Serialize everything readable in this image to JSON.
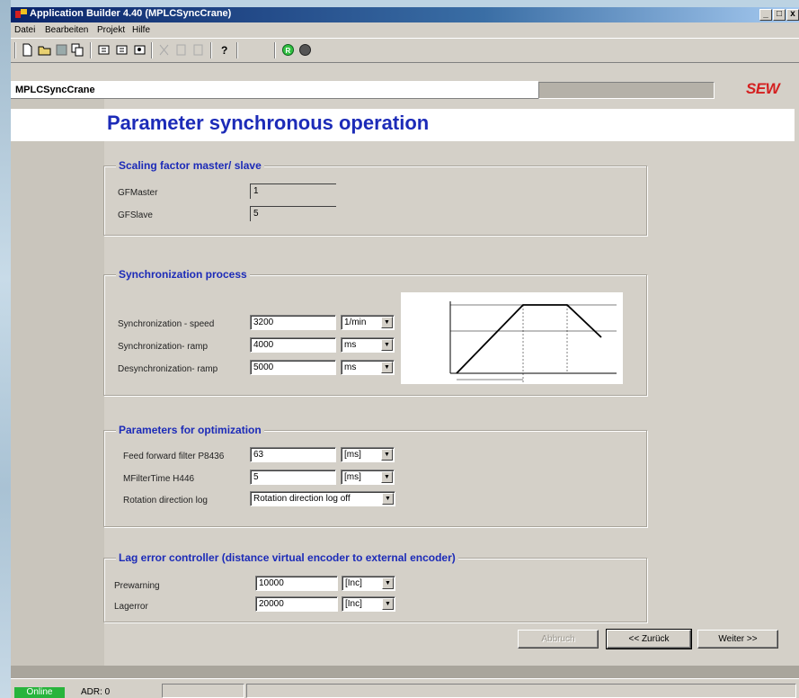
{
  "window": {
    "title": "Application Builder  4.40 (MPLCSyncCrane)",
    "controls": {
      "minimize": "_",
      "maximize": "□",
      "close": "x"
    }
  },
  "menu": {
    "items": [
      {
        "label": "Datei"
      },
      {
        "label": "Bearbeiten"
      },
      {
        "label": "Projekt"
      },
      {
        "label": "Hilfe"
      }
    ]
  },
  "header": {
    "project_name": "MPLCSyncCrane",
    "logo_text": "SEW"
  },
  "page": {
    "title": "Parameter synchronous operation"
  },
  "scaling": {
    "legend": "Scaling factor master/ slave",
    "gf_master_label": "GFMaster",
    "gf_master_value": "1",
    "gf_slave_label": "GFSlave",
    "gf_slave_value": "5"
  },
  "sync": {
    "legend": "Synchronization process",
    "speed_label": "Synchronization - speed",
    "speed_value": "3200",
    "speed_unit": "1/min",
    "ramp_label": "Synchronization- ramp",
    "ramp_value": "4000",
    "ramp_unit": "ms",
    "desync_label": "Desynchronization- ramp",
    "desync_value": "5000",
    "desync_unit": "ms"
  },
  "optimization": {
    "legend": "Parameters for optimization",
    "ff_label": "Feed forward filter P8436",
    "ff_value": "63",
    "ff_unit": "[ms]",
    "mfilter_label": "MFilterTime H446",
    "mfilter_value": "5",
    "mfilter_unit": "[ms]",
    "rotation_label": "Rotation direction log",
    "rotation_value": "Rotation direction log off"
  },
  "lag": {
    "legend": "Lag error controller (distance virtual encoder to external encoder)",
    "prewarning_label": "Prewarning",
    "prewarning_value": "10000",
    "prewarning_unit": "[Inc]",
    "lagerror_label": "Lagerror",
    "lagerror_value": "20000",
    "lagerror_unit": "[Inc]"
  },
  "buttons": {
    "cancel": "Abbruch",
    "back": "<< Zurück",
    "next": "Weiter >>"
  },
  "status": {
    "online": "Online",
    "address": "ADR: 0"
  }
}
